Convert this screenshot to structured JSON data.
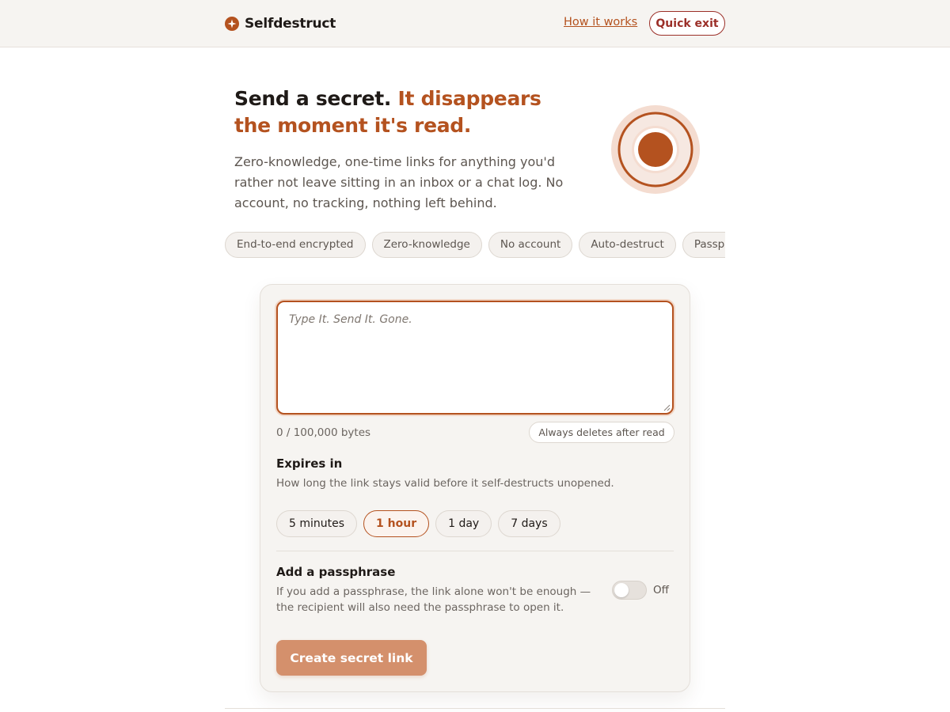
{
  "header": {
    "brand_name": "Selfdestruct",
    "brand_icon": "sparkle-badge-icon",
    "how_it_works": "How it works",
    "quick_exit": "Quick exit"
  },
  "hero": {
    "title_lead": "Send a secret.",
    "title_accent": "It disappears the moment it's read.",
    "subtitle": "Zero-knowledge, one-time links for anything you'd rather not leave sitting in an inbox or a chat log. No account, no tracking, nothing left behind.",
    "graphic_icon": "target-rings-icon"
  },
  "features": [
    "End-to-end encrypted",
    "Zero-knowledge",
    "No account",
    "Auto-destruct",
    "Passphrase"
  ],
  "form": {
    "placeholder": "Type It. Send It. Gone.",
    "value": "",
    "byte_count": "0 / 100,000 bytes",
    "delete_note": "Always deletes after read",
    "expires": {
      "title": "Expires in",
      "description": "How long the link stays valid before it self-destructs unopened.",
      "options": [
        "5 minutes",
        "1 hour",
        "1 day",
        "7 days"
      ],
      "selected": "1 hour"
    },
    "passphrase": {
      "title": "Add a passphrase",
      "description": "If you add a passphrase, the link alone won't be enough — the recipient will also need the passphrase to open it.",
      "toggle_state": "Off"
    },
    "create_button": "Create secret link"
  },
  "colors": {
    "accent": "#b4521f",
    "danger": "#9b2f28",
    "button_disabled": "#d4906c"
  }
}
